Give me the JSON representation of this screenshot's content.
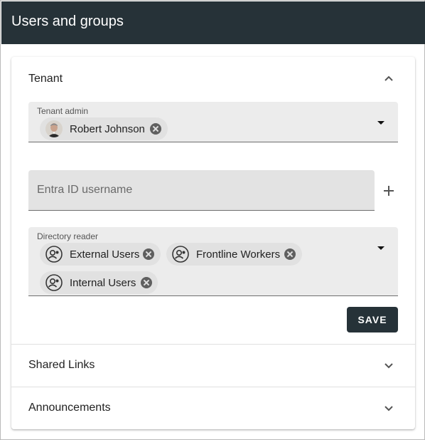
{
  "header": {
    "title": "Users and groups"
  },
  "sections": {
    "tenant": {
      "title": "Tenant",
      "expanded": true,
      "tenant_admin": {
        "label": "Tenant admin",
        "chips": [
          {
            "text": "Robert Johnson",
            "icon": "user-avatar-photo"
          }
        ]
      },
      "entra_input": {
        "placeholder": "Entra ID username",
        "value": ""
      },
      "directory_reader": {
        "label": "Directory reader",
        "chips": [
          {
            "text": "External Users",
            "icon": "group-icon"
          },
          {
            "text": "Frontline Workers",
            "icon": "group-icon"
          },
          {
            "text": "Internal Users",
            "icon": "group-icon"
          }
        ]
      },
      "save_label": "SAVE"
    },
    "shared_links": {
      "title": "Shared Links",
      "expanded": false
    },
    "announcements": {
      "title": "Announcements",
      "expanded": false
    }
  },
  "colors": {
    "header_bg": "#263238",
    "button_bg": "#263238",
    "field_bg": "#ececec",
    "chip_bg": "#e1e1e1"
  }
}
